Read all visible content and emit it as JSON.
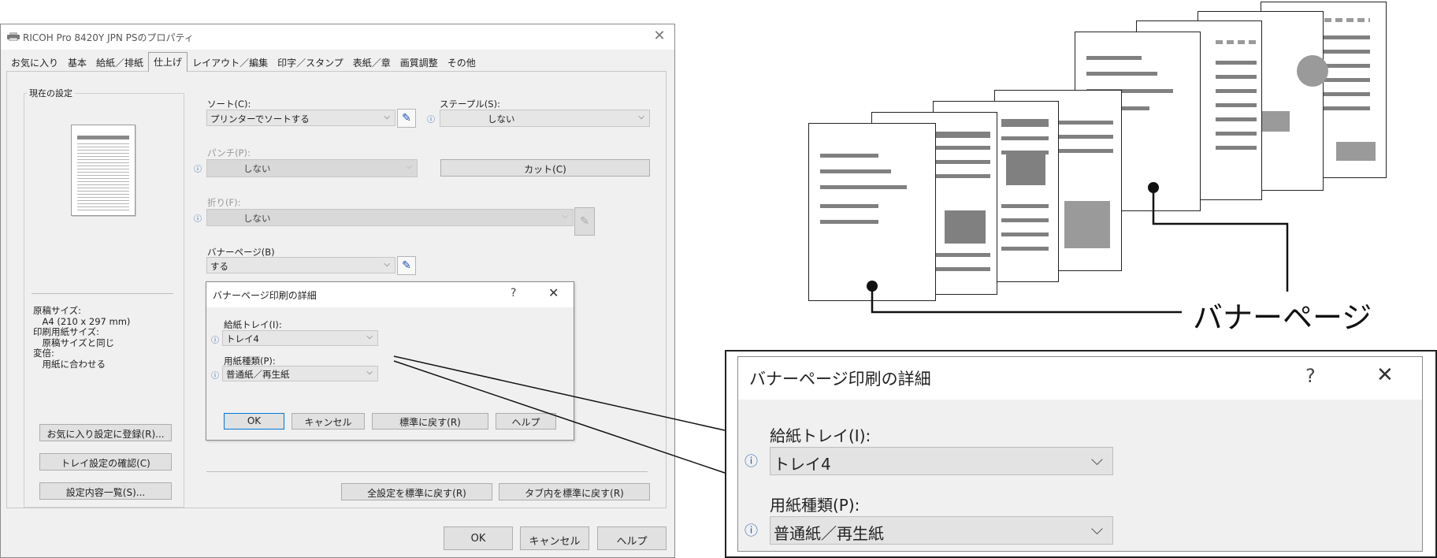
{
  "window": {
    "title": "RICOH Pro 8420Y JPN PSのプロパティ",
    "close_glyph": "✕"
  },
  "tabs": [
    "お気に入り",
    "基本",
    "給紙／排紙",
    "仕上げ",
    "レイアウト／編集",
    "印字／スタンプ",
    "表紙／章",
    "画質調整",
    "その他"
  ],
  "active_tab_index": 3,
  "current_settings": {
    "legend": "現在の設定",
    "info_lines": [
      "原稿サイズ:",
      "　A4 (210 x 297 mm)",
      "印刷用紙サイズ:",
      "　原稿サイズと同じ",
      "変倍:",
      "　用紙に合わせる"
    ],
    "buttons": [
      "お気に入り設定に登録(R)...",
      "トレイ設定の確認(C)",
      "設定内容一覧(S)..."
    ]
  },
  "finishing": {
    "sort": {
      "label": "ソート(C):",
      "value": "プリンターでソートする"
    },
    "staple": {
      "label": "ステープル(S):",
      "value": "しない"
    },
    "punch": {
      "label": "パンチ(P):",
      "value": "しない"
    },
    "cut_button": "カット(C)",
    "fold": {
      "label": "折り(F):",
      "value": "しない"
    },
    "banner": {
      "label": "バナーページ(B)",
      "value": "する"
    }
  },
  "reset_all_button": "全設定を標準に戻す(R)",
  "reset_tab_button": "タブ内を標準に戻す(R)",
  "footer_buttons": {
    "ok": "OK",
    "cancel": "キャンセル",
    "help": "ヘルプ"
  },
  "banner_dialog": {
    "title": "バナーページ印刷の詳細",
    "help_glyph": "?",
    "close_glyph": "✕",
    "tray": {
      "label": "給紙トレイ(I):",
      "value": "トレイ4"
    },
    "paper_type": {
      "label": "用紙種類(P):",
      "value": "普通紙／再生紙"
    },
    "buttons": {
      "ok": "OK",
      "cancel": "キャンセル",
      "default": "標準に戻す(R)",
      "help": "ヘルプ"
    }
  },
  "callout_label": "バナーページ",
  "icons": {
    "info": "info-icon",
    "pencil": "pencil-icon",
    "chevron": "chevron-down-icon",
    "printer": "printer-icon"
  },
  "colors": {
    "panel_bg": "#f0f0f0",
    "info_icon": "#2461b8",
    "pencil_icon": "#1a4fb5"
  }
}
